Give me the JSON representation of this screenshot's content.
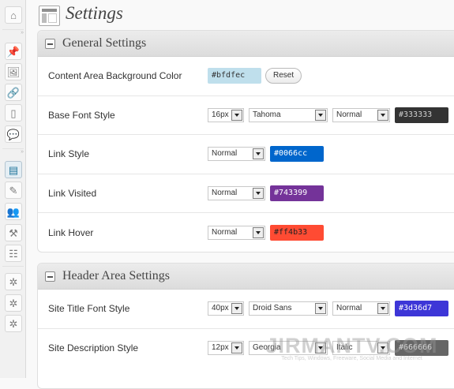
{
  "page": {
    "title": "Settings"
  },
  "sidebar": {
    "icons": [
      {
        "name": "dashboard-icon",
        "glyph": "⌂",
        "active": false
      },
      {
        "name": "posts-icon",
        "glyph": "📌",
        "active": false
      },
      {
        "name": "media-icon",
        "glyph": "🖼",
        "active": false
      },
      {
        "name": "links-icon",
        "glyph": "🔗",
        "active": false
      },
      {
        "name": "pages-icon",
        "glyph": "▯",
        "active": false
      },
      {
        "name": "comments-icon",
        "glyph": "💬",
        "active": false
      },
      {
        "name": "appearance-icon",
        "glyph": "▤",
        "active": true
      },
      {
        "name": "plugins-icon",
        "glyph": "✎",
        "active": false
      },
      {
        "name": "users-icon",
        "glyph": "👥",
        "active": false
      },
      {
        "name": "tools-icon",
        "glyph": "⚒",
        "active": false
      },
      {
        "name": "settings-icon",
        "glyph": "☷",
        "active": false
      },
      {
        "name": "extra-icon-1",
        "glyph": "✲",
        "active": false
      },
      {
        "name": "extra-icon-2",
        "glyph": "✲",
        "active": false
      },
      {
        "name": "extra-icon-3",
        "glyph": "✲",
        "active": false
      }
    ]
  },
  "general": {
    "title": "General Settings",
    "content_bg": {
      "label": "Content Area Background Color",
      "color": "#bfdfec",
      "reset_label": "Reset"
    },
    "base_font": {
      "label": "Base Font Style",
      "size": "16px",
      "family": "Tahoma",
      "style": "Normal",
      "color": "#333333"
    },
    "link": {
      "label": "Link Style",
      "style": "Normal",
      "color": "#0066cc"
    },
    "visited": {
      "label": "Link Visited",
      "style": "Normal",
      "color": "#743399"
    },
    "hover": {
      "label": "Link Hover",
      "style": "Normal",
      "color": "#ff4b33"
    }
  },
  "header": {
    "title": "Header Area Settings",
    "site_title": {
      "label": "Site Title Font Style",
      "size": "40px",
      "family": "Droid Sans",
      "style": "Normal",
      "color": "#3d36d7"
    },
    "site_desc": {
      "label": "Site Description Style",
      "size": "12px",
      "family": "Georgia",
      "style": "Italic",
      "color": "#666666"
    }
  },
  "watermark": {
    "main": "JIRMANTV.COM",
    "sub": "Tech Tips, Windows, Freeware, Social Media and Internet"
  }
}
